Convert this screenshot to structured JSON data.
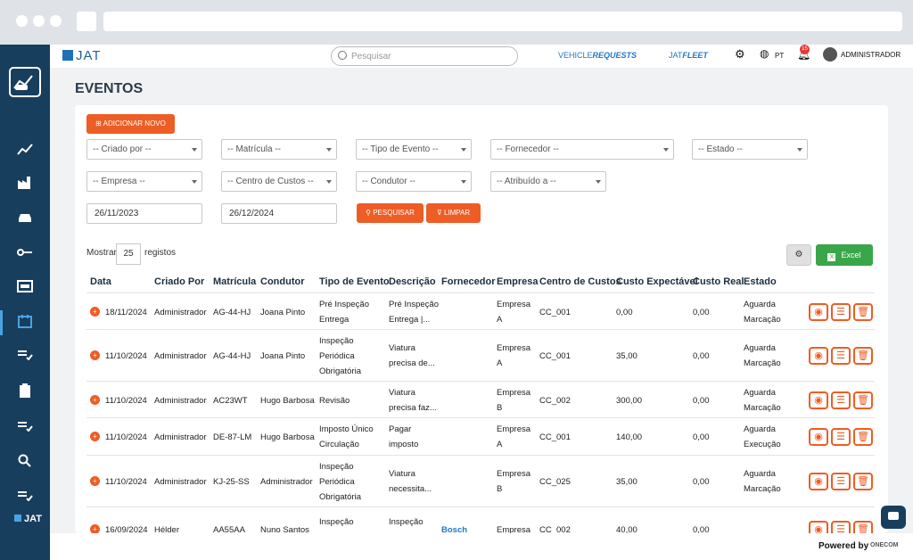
{
  "header": {
    "logo": "JAT",
    "search_placeholder": "Pesquisar",
    "brand1_a": "VEHICLE",
    "brand1_b": "REQUESTS",
    "brand2_a": "JAT",
    "brand2_b": "FLEET",
    "lang": "PT",
    "notif_count": "15",
    "user": "ADMINISTRADOR"
  },
  "sidebar": {
    "footer_logo": "JAT"
  },
  "page": {
    "title": "EVENTOS"
  },
  "actions": {
    "add_new": "ADICIONAR NOVO",
    "search": "PESQUISAR",
    "clear": "LIMPAR",
    "excel": "Excel"
  },
  "filters": {
    "criado_por": "-- Criado por --",
    "matricula": "-- Matrícula --",
    "tipo_evento": "-- Tipo de Evento --",
    "fornecedor": "-- Fornecedor --",
    "estado": "-- Estado --",
    "empresa": "-- Empresa --",
    "centro_custos": "-- Centro de Custos --",
    "condutor": "-- Condutor --",
    "atribuido": "-- Atribuído a --",
    "date_from": "26/11/2023",
    "date_to": "26/12/2024"
  },
  "paging": {
    "show_label": "Mostrar",
    "page_size": "25",
    "records_label": "registos"
  },
  "table": {
    "columns": [
      "Data",
      "Criado Por",
      "Matrícula",
      "Condutor",
      "Tipo de Evento",
      "Descrição",
      "Fornecedor",
      "Empresa",
      "Centro de Custos",
      "Custo Expectável",
      "Custo Real",
      "Estado"
    ],
    "rows": [
      {
        "data": "18/11/2024",
        "criado": "Administrador",
        "matricula": "AG-44-HJ",
        "condutor": "Joana Pinto",
        "tipo": "Pré Inspeção\nEntrega",
        "descricao": "Pré Inspeção\nEntrega |...",
        "fornecedor": "",
        "empresa": "Empresa\nA",
        "centro": "CC_001",
        "custo_exp": "0,00",
        "custo_real": "0,00",
        "estado": "Aguarda\nMarcação"
      },
      {
        "data": "11/10/2024",
        "criado": "Administrador",
        "matricula": "AG-44-HJ",
        "condutor": "Joana Pinto",
        "tipo": "Inspeção\nPeriódica\nObrigatória",
        "descricao": "Viatura\nprecisa de...",
        "fornecedor": "",
        "empresa": "Empresa\nA",
        "centro": "CC_001",
        "custo_exp": "35,00",
        "custo_real": "0,00",
        "estado": "Aguarda\nMarcação"
      },
      {
        "data": "11/10/2024",
        "criado": "Administrador",
        "matricula": "AC23WT",
        "condutor": "Hugo Barbosa",
        "tipo": "Revisão",
        "descricao": "Viatura\nprecisa faz...",
        "fornecedor": "",
        "empresa": "Empresa\nB",
        "centro": "CC_002",
        "custo_exp": "300,00",
        "custo_real": "0,00",
        "estado": "Aguarda\nMarcação"
      },
      {
        "data": "11/10/2024",
        "criado": "Administrador",
        "matricula": "DE-87-LM",
        "condutor": "Hugo Barbosa",
        "tipo": "Imposto Único\nCirculação",
        "descricao": "Pagar\nimposto",
        "fornecedor": "",
        "empresa": "Empresa\nA",
        "centro": "CC_001",
        "custo_exp": "140,00",
        "custo_real": "0,00",
        "estado": "Aguarda\nExecução"
      },
      {
        "data": "11/10/2024",
        "criado": "Administrador",
        "matricula": "KJ-25-SS",
        "condutor": "Administrador",
        "tipo": "Inspeção\nPeriódica\nObrigatória",
        "descricao": "Viatura\nnecessita...",
        "fornecedor": "",
        "empresa": "Empresa\nB",
        "centro": "CC_025",
        "custo_exp": "35,00",
        "custo_real": "0,00",
        "estado": "Aguarda\nMarcação"
      },
      {
        "data": "16/09/2024",
        "criado": "Hélder",
        "matricula": "AA55AA",
        "condutor": "Nuno Santos",
        "tipo": "Inspeção\nPeriódica",
        "descricao": "Inspeção\nobrigatória",
        "fornecedor": "Bosch",
        "empresa": "Empresa",
        "centro": "CC_002",
        "custo_exp": "40,00",
        "custo_real": "0,00",
        "estado": ""
      }
    ]
  },
  "footer": {
    "powered": "Powered by",
    "brand": "ONECOM"
  },
  "colors": {
    "accent": "#ee5d25",
    "sidebar": "#183e5e",
    "excel": "#3aa64a",
    "link": "#2077c9"
  }
}
